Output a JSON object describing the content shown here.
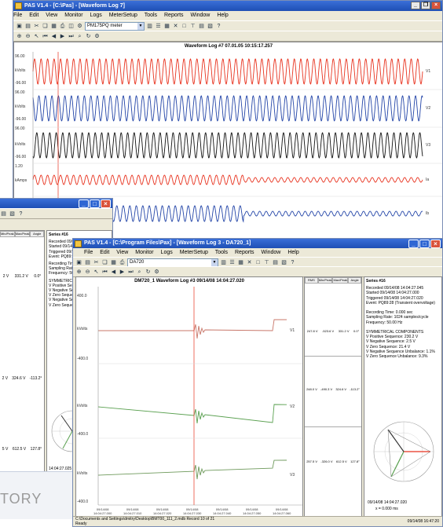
{
  "main_window": {
    "title": "PAS V1.4 - [C:\\Pas] - [Waveform Log 7]",
    "menu": [
      "File",
      "Edit",
      "View",
      "Monitor",
      "Logs",
      "MeterSetup",
      "Tools",
      "Reports",
      "Window",
      "Help"
    ],
    "device_combo": "PM175PQ meter",
    "chart_title": "Waveform Log #7   07.01.05   10:15:17.257",
    "y_ticks": [
      {
        "label": "96.00"
      },
      {
        "label": "kVolts"
      },
      {
        "label": "-96.00"
      },
      {
        "label": "96.00"
      },
      {
        "label": "kVolts"
      },
      {
        "label": "-96.00"
      },
      {
        "label": "96.00"
      },
      {
        "label": "kVolts"
      },
      {
        "label": "-96.00"
      },
      {
        "label": "1.20"
      },
      {
        "label": "kAmps"
      }
    ],
    "channels": [
      "V1",
      "V2",
      "V3",
      "Ia",
      "Ib"
    ]
  },
  "colors": {
    "red": "#e8321e",
    "blue": "#2345a8",
    "black": "#111111",
    "green": "#5aa050",
    "dark": "#333333"
  },
  "second_window": {
    "series_label": "Series #16",
    "recorded_lines": [
      "Recorded 09/14/08",
      "Started 09/14/08",
      "Triggered 09/14/08",
      "Event: PQ89:28 (Tr"
    ],
    "recording_lines": [
      "Recording Time: 0.0",
      "Sampling Rate: 102",
      "Frequency: 50.00 Hz"
    ],
    "sym_lines": [
      "SYMMETRICAL COMP",
      "V Positive Sequenc",
      "V Negative Sequenc",
      "V Zero Sequence: 2",
      "V Negative Sequenc",
      "V Zero Sequence Un"
    ],
    "hdr": [
      "RMS",
      "Min/Peak",
      "Max/Peak",
      "Angle"
    ],
    "row1": [
      "2 V",
      "331.2 V",
      "0.0°"
    ],
    "row2": [
      "2 V",
      "324.6 V",
      "-113.2°"
    ],
    "row3": [
      "5 V",
      "612.5 V",
      "127.8°"
    ],
    "bottom_time": "14:04:27.025"
  },
  "third_window": {
    "title": "PAS V1.4 - [C:\\Program Files\\Pax] - [Waveform Log 3 - DA720_1]",
    "menu": [
      "File",
      "Edit",
      "View",
      "Monitor",
      "Logs",
      "MeterSetup",
      "Tools",
      "Reports",
      "Window",
      "Help"
    ],
    "device_combo": "DA720",
    "chart_title": "DM720_1  Waveform Log #3   09/14/08   14:04:27.020",
    "y_ticks": [
      {
        "label": "400.0"
      },
      {
        "label": "kVolts"
      },
      {
        "label": "-400.0"
      },
      {
        "label": "kVolts"
      },
      {
        "label": "-400.0"
      },
      {
        "label": "kVolts"
      },
      {
        "label": "-400.0"
      }
    ],
    "channels": [
      "V1",
      "V2",
      "V3"
    ],
    "x_ticks": [
      "09/14/08\n14:04:27.000",
      "09/14/08\n14:04:27.010",
      "09/14/08\n14:04:27.020",
      "09/14/08\n14:04:27.030",
      "09/14/08\n14:04:27.040",
      "09/14/08\n14:04:27.050",
      "09/14/08\n14:04:27.060"
    ],
    "hdr": [
      "RMS",
      "Min/Peak",
      "Max/Peak",
      "Angle"
    ],
    "row1": [
      "247.8 V",
      "-523.6 V",
      "331.2 V",
      "0.0°"
    ],
    "row2": [
      "248.0 V",
      "-490.3 V",
      "324.6 V",
      "-113.2°"
    ],
    "row3": [
      "257.5 V",
      "-326.0 V",
      "612.5 V",
      "127.8°"
    ],
    "series_label": "Series #16",
    "info_lines": [
      "Recorded 09/14/08  14:04:27.045",
      "Started    09/14/08  14:04:27.000",
      "Triggered 09/14/08  14:04:27.020",
      "Event: PQ89:28 (Transient overvoltage)",
      "",
      "Recording Time: 0.000 sec",
      "Sampling Rate: 1024 samples/cycle",
      "Frequency: 50.00 Hz",
      "",
      "SYMMETRICAL COMPONENTS",
      "V Positive Sequence: 230.2 V",
      "V Negative Sequence: 2.5 V",
      "V Zero Sequence: 21.4 V",
      "V Negative Sequence Unbalance: 1.1%",
      "V Zero Sequence Unbalance: 9.3%"
    ],
    "bottom_time": "09/14/08  14:04:27.020",
    "bottom_x": "x = 0.000 ms",
    "status_path": "C:\\Documents and Settings\\dmitry\\Desktop\\BMT00_111_2.mdb   Record 10 of 21",
    "status_ready": "Ready",
    "status_right": "09/14/08  16:47:20"
  },
  "footer_text": "TORY"
}
